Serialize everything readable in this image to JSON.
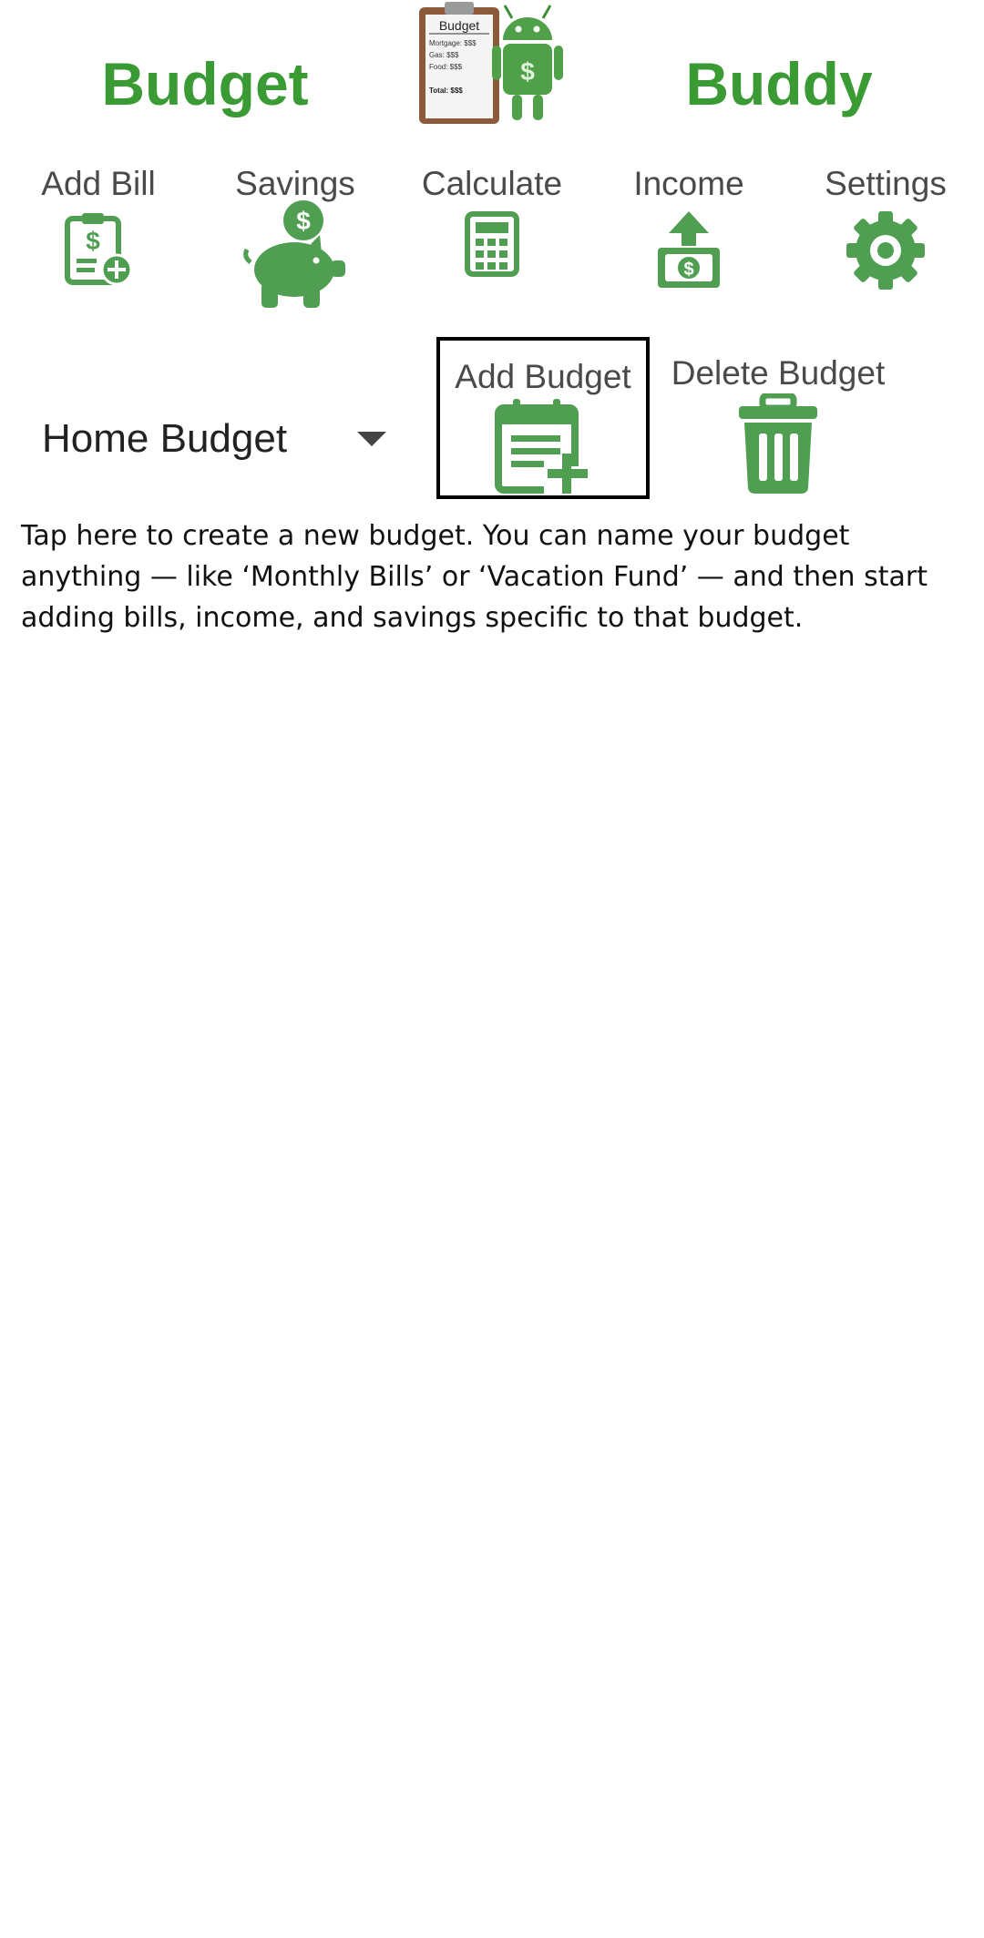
{
  "colors": {
    "brand": "#3a9a33",
    "icon": "#4f9e52",
    "highlight_border": "#000000"
  },
  "header": {
    "title_left": "Budget",
    "title_right": "Buddy",
    "logo": {
      "icon": "budget-buddy-logo",
      "clipboard_title": "Budget",
      "lines": [
        "Mortgage: $$$",
        "Gas: $$$",
        "Food: $$$"
      ],
      "total": "Total: $$$"
    }
  },
  "toolbar": {
    "items": [
      {
        "label": "Add Bill",
        "icon": "bill-add-icon"
      },
      {
        "label": "Savings",
        "icon": "piggy-bank-icon"
      },
      {
        "label": "Calculate",
        "icon": "calculator-icon"
      },
      {
        "label": "Income",
        "icon": "income-upload-icon"
      },
      {
        "label": "Settings",
        "icon": "gear-icon"
      }
    ]
  },
  "budget": {
    "selected": "Home Budget",
    "add_label": "Add Budget",
    "delete_label": "Delete Budget"
  },
  "hint": {
    "text": "Tap here to create a new budget. You can name your budget anything — like ‘Monthly Bills’ or ‘Vacation Fund’ — and then start adding bills, income, and savings specific to that budget."
  }
}
